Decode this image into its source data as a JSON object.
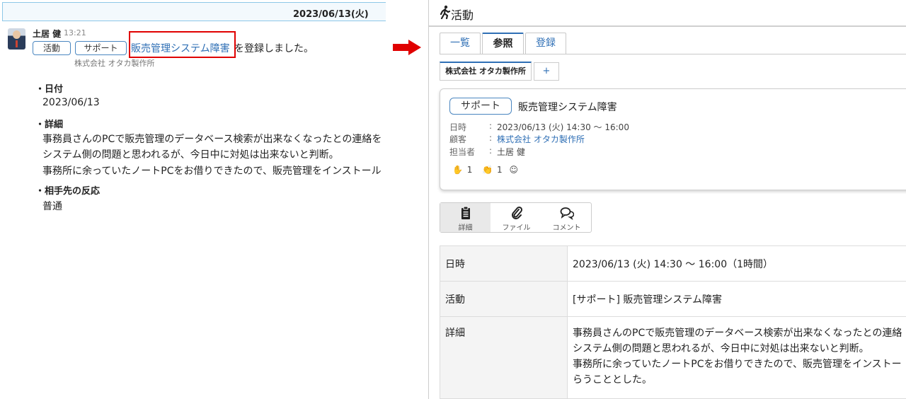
{
  "left": {
    "date_header": "2023/06/13(火)",
    "post": {
      "user_name": "土居 健",
      "time": "13:21",
      "tags": [
        "活動",
        "サポート"
      ],
      "activity_link": "販売管理システム障害",
      "suffix": "を登録しました。",
      "company": "株式会社 オタカ製作所"
    },
    "sections": [
      {
        "heading": "・日付",
        "lines": [
          "2023/06/13"
        ]
      },
      {
        "heading": "・詳細",
        "lines": [
          "事務員さんのPCで販売管理のデータベース検索が出来なくなったとの連絡を",
          "システム側の問題と思われるが、今日中に対処は出来ないと判断。",
          "事務所に余っていたノートPCをお借りできたので、販売管理をインストール"
        ]
      },
      {
        "heading": "・相手先の反応",
        "lines": [
          "普通"
        ]
      }
    ]
  },
  "right": {
    "header_title": "活動",
    "tabs": [
      "一覧",
      "参照",
      "登録"
    ],
    "sub_tabs": {
      "company": "株式会社 オタカ製作所",
      "add": "+"
    },
    "card": {
      "tag": "サポート",
      "title": "販売管理システム障害",
      "meta": [
        {
          "label": "日時",
          "colon": ":",
          "value": "2023/06/13 (火) 14:30 〜 16:00"
        },
        {
          "label": "顧客",
          "colon": ":",
          "value": "株式会社 オタカ製作所"
        },
        {
          "label": "担当者",
          "colon": ":",
          "value": "土居 健"
        }
      ],
      "reactions": {
        "hand_count": "1",
        "clap_count": "1"
      }
    },
    "view_buttons": [
      "詳細",
      "ファイル",
      "コメント"
    ],
    "detail_table": {
      "rows": [
        {
          "key": "日時",
          "value": "2023/06/13 (火) 14:30 〜 16:00（1時間）"
        },
        {
          "key": "活動",
          "value": "[サポート] 販売管理システム障害"
        },
        {
          "key": "詳細",
          "lines": [
            "事務員さんのPCで販売管理のデータベース検索が出来なくなったとの連絡",
            "システム側の問題と思われるが、今日中に対処は出来ないと判断。",
            "事務所に余っていたノートPCをお借りできたので、販売管理をインストー",
            "らうこととした。"
          ]
        }
      ]
    }
  },
  "colors": {
    "accent_blue": "#2f6fb5",
    "highlight_red": "#e00000",
    "arrow_red": "#e00000"
  }
}
